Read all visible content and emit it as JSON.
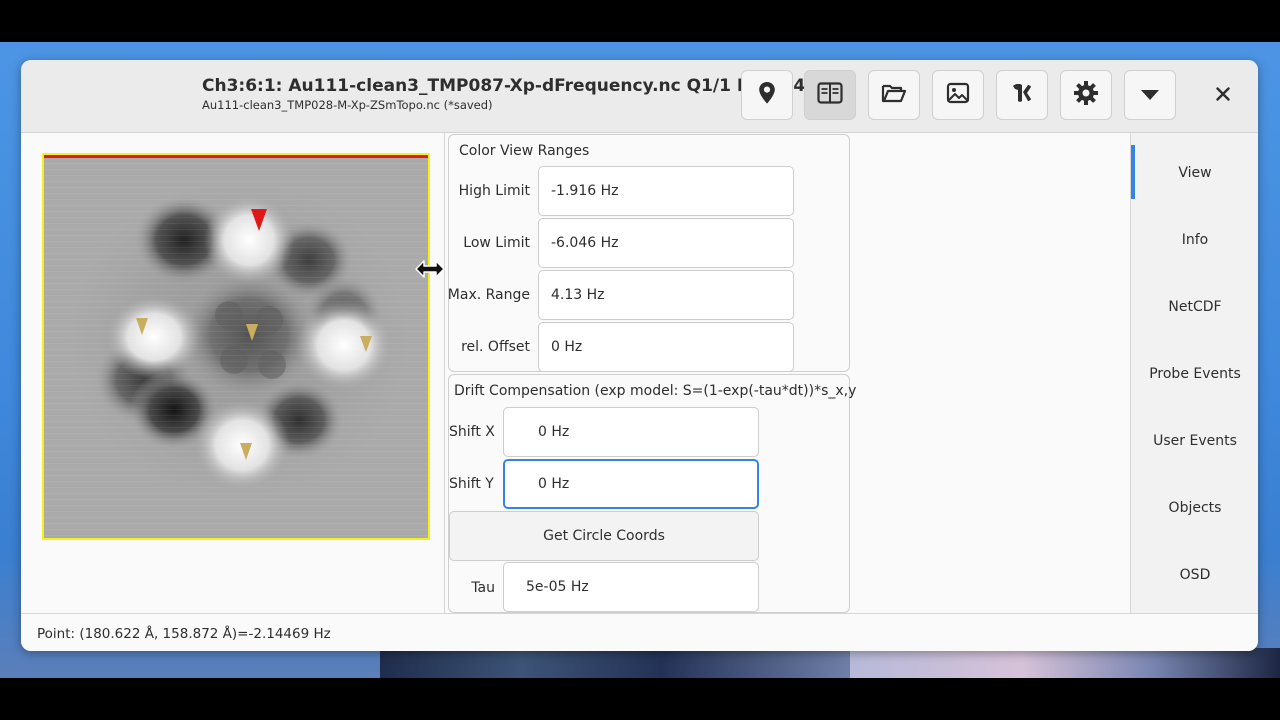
{
  "window": {
    "title": "Ch3:6:1: Au111-clean3_TMP087-Xp-dFrequency.nc Q1/1 Float[4]",
    "subtitle": "Au111-clean3_TMP028-M-Xp-ZSmTopo.nc (*saved)"
  },
  "toolbar": {
    "buttons": [
      {
        "icon": "location-pin-icon"
      },
      {
        "icon": "split-view-icon",
        "active": true
      },
      {
        "icon": "open-folder-icon"
      },
      {
        "icon": "image-icon"
      },
      {
        "icon": "tools-icon"
      },
      {
        "icon": "gear-icon"
      },
      {
        "icon": "chevron-down-icon"
      }
    ],
    "close_icon": "close-icon"
  },
  "color_view": {
    "frame_label": "Color View Ranges",
    "high_limit": {
      "label": "High Limit",
      "value": "-1.916 Hz"
    },
    "low_limit": {
      "label": "Low Limit",
      "value": "-6.046 Hz"
    },
    "max_range": {
      "label": "Max. Range",
      "value": "4.13 Hz"
    },
    "rel_offset": {
      "label": "rel. Offset",
      "value": "0 Hz"
    }
  },
  "drift": {
    "frame_label": "Drift Compensation (exp model: S=(1-exp(-tau*dt))*s_x,y",
    "shift_x": {
      "label": "Shift X",
      "value": "0 Hz"
    },
    "shift_y": {
      "label": "Shift Y",
      "value": "0 Hz"
    },
    "circle_button": "Get Circle Coords",
    "tau": {
      "label": "Tau",
      "value": "5e-05 Hz"
    }
  },
  "sidebar": {
    "items": [
      {
        "label": "View",
        "selected": true
      },
      {
        "label": "Info"
      },
      {
        "label": "NetCDF"
      },
      {
        "label": "Probe Events"
      },
      {
        "label": "User Events"
      },
      {
        "label": "Objects"
      },
      {
        "label": "OSD"
      }
    ]
  },
  "status": {
    "text": "Point: (180.622 Å, 158.872 Å)=-2.14469 Hz"
  },
  "colors": {
    "accent": "#3584e4",
    "scan_border": "#f3f319",
    "marker_active": "#e01818",
    "marker_inactive": "#c8ae5e"
  }
}
